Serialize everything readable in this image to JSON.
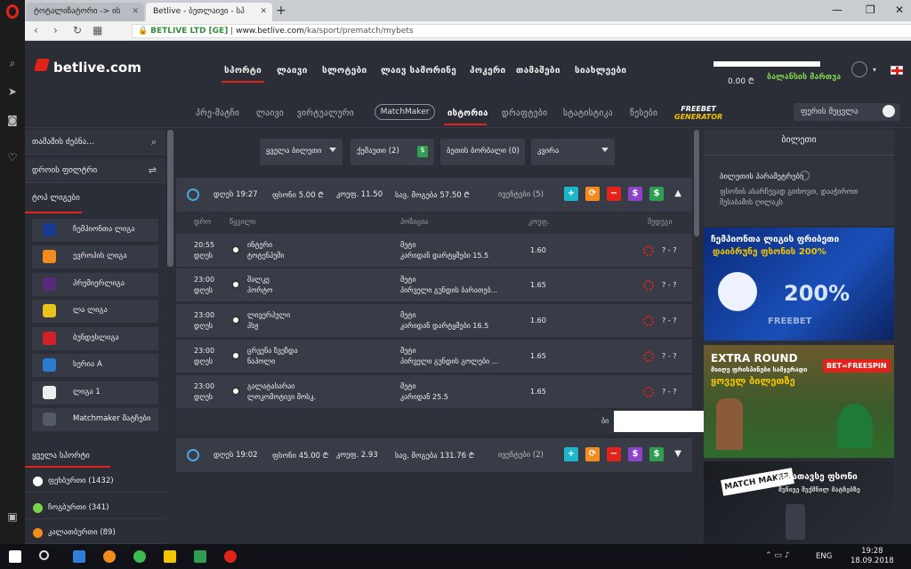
{
  "browser": {
    "tab1_title": "ტოტალიზატორი -> ის",
    "tab2_title": "Betlive - ბეთლაივი - სპ",
    "url_secure_label": "BETLIVE LTD [GE]",
    "url_domain": "www.betlive.com",
    "url_path": "/ka/sport/prematch/mybets",
    "new_tab": "+",
    "win_min": "—",
    "win_max": "❐",
    "win_close": "✕"
  },
  "site": {
    "logo": "betlive.com",
    "balance": "0.00",
    "currency": "₾",
    "balance_check_label": "ბალანსის მართვა"
  },
  "main_nav": [
    "სპორტი",
    "ლაივი",
    "სლოტები",
    "ლაივ სამორინე",
    "პოკერი",
    "თამაშები",
    "სიახლეები"
  ],
  "sub_nav": {
    "items": [
      "პრე-მატჩი",
      "ლაივი",
      "ვირტუალური"
    ],
    "matchmaker": "MatchMaker",
    "history": "ისტორია",
    "items2": [
      "დრაფტები",
      "სტატისტიკა",
      "წესები"
    ],
    "freebet_top": "FREEBET",
    "freebet_bottom": "GENERATOR",
    "quick_bet": "ფერის შეცვლა"
  },
  "left": {
    "search": "თამაშის ძებნა...",
    "time_filter": "დროის ფილტრი",
    "top_leagues": "ტოპ ლიგები",
    "leagues": [
      "ჩემპიონთა ლიგა",
      "ევროპის ლიგა",
      "პრემიერლიგა",
      "ლა ლიგა",
      "ბუნდესლიგა",
      "სერია A",
      "ლიგა 1",
      "Matchmaker მატჩები"
    ],
    "all_sports": "ყველა სპორტი",
    "sports": [
      {
        "name": "ფეხბურთი (1432)",
        "color": "#ffffff"
      },
      {
        "name": "ჩოგბურთი (341)",
        "color": "#7bd34b"
      },
      {
        "name": "კალათბურთი (89)",
        "color": "#f28c1e"
      }
    ]
  },
  "filters": {
    "all_bets": "ყველა ბილეთი",
    "status": "ქეშაუთი (2)",
    "bet_types": "ბეთის ბორბალი (0)",
    "period": "კვირა"
  },
  "bets": [
    {
      "date": "დღეს 19:27",
      "stake_label": "ფსონი",
      "stake": "5.00 ₾",
      "odds_label": "კოეფ.",
      "odds": "11.50",
      "win_label": "სავ. მოგება",
      "win": "57.50 ₾",
      "events": "ივენტები (5)",
      "expanded": true
    },
    {
      "date": "დღეს 19:02",
      "stake_label": "ფსონი",
      "stake": "45.00 ₾",
      "odds_label": "კოეფ.",
      "odds": "2.93",
      "win_label": "სავ. მოგება",
      "win": "131.76 ₾",
      "events": "ივენტები (2)",
      "expanded": false
    }
  ],
  "columns": {
    "time": "დრო",
    "event": "წყვილი",
    "market": "პოზიცია",
    "odds": "კოეფ.",
    "result": "შედეგი"
  },
  "rows": [
    {
      "time": "20:55",
      "day": "დღეს",
      "team1": "ინტერი",
      "team2": "ტოტენჰემი",
      "market": "მეტი",
      "selection": "კარიდან დარტყმები 15.5",
      "odds": "1.60",
      "score": "? - ?"
    },
    {
      "time": "23:00",
      "day": "დღეს",
      "team1": "შალკე",
      "team2": "პორტო",
      "market": "მეტი",
      "selection": "პირველი გუნდის ბარათებ...",
      "odds": "1.65",
      "score": "? - ?"
    },
    {
      "time": "23:00",
      "day": "დღეს",
      "team1": "ლივერპული",
      "team2": "პსჟ",
      "market": "მეტი",
      "selection": "კარიდან დარტყმები 16.5",
      "odds": "1.60",
      "score": "? - ?"
    },
    {
      "time": "23:00",
      "day": "დღეს",
      "team1": "ცრვენა ზვეზდა",
      "team2": "ნაპოლი",
      "market": "მეტი",
      "selection": "პირველი გუნდის გოლები ...",
      "odds": "1.65",
      "score": "? - ?"
    },
    {
      "time": "23:00",
      "day": "დღეს",
      "team1": "გალატასარაი",
      "team2": "ლოკომოტივი მოსკ.",
      "market": "მეტი",
      "selection": "კარიდან 25.5",
      "odds": "1.65",
      "score": "? - ?"
    }
  ],
  "total_label": "ბი",
  "slip": {
    "title": "ბილეთი",
    "settings": "ბილეთის პარამეტრები",
    "desc": "ფსონის ასარჩევად გთხოვთ, დააჭიროთ შესაბამის ღილაკს"
  },
  "banners": {
    "b1_line1": "ჩემპიონთა ლიგის ფრიბეთი",
    "b1_line2": "დაიბრუნე ფსონის 200%",
    "b1_pct": "200%",
    "b1_freebet": "FREEBET",
    "b2_line1": "EXTRA ROUND",
    "b2_line2": "მიიღე ფრისპინები სამჯერადი",
    "b2_line3": "ყოველ ბილეთზე",
    "b2_badge": "BET=FREESPIN",
    "b3_line1": "განათავსე ფსონი",
    "b3_line2": "შენივე შექმნილ მატჩებზე",
    "b3_logo": "MATCH MAKER"
  },
  "taskbar": {
    "lang": "ENG",
    "time": "19:28",
    "date": "18.09.2018"
  }
}
